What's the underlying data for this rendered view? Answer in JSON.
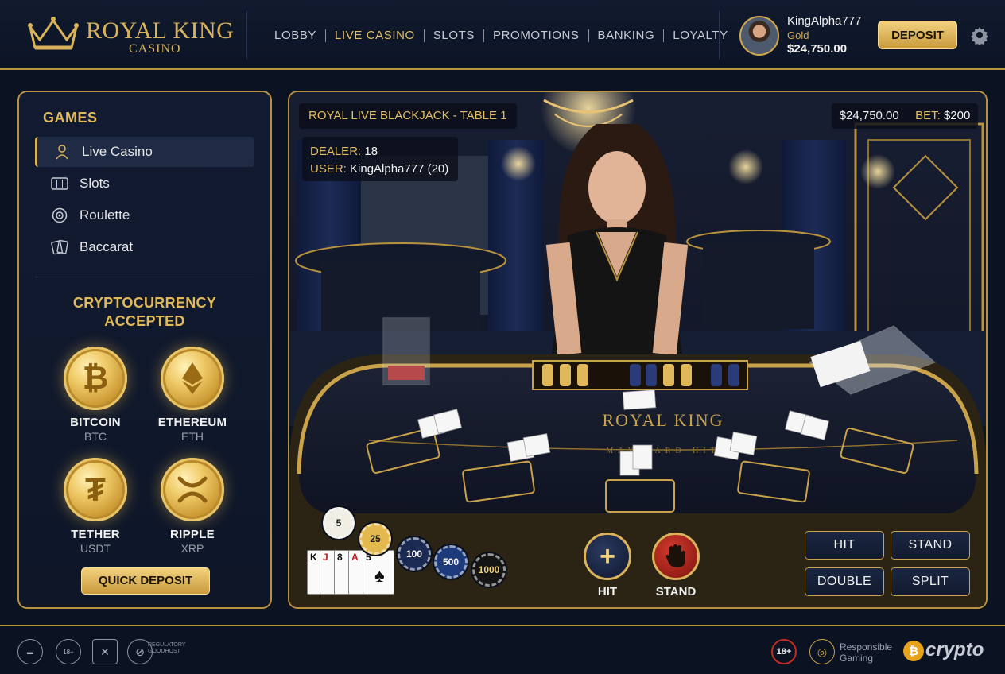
{
  "brand": {
    "name": "ROYAL KING",
    "sub": "CASINO"
  },
  "nav": [
    "LOBBY",
    "LIVE CASINO",
    "SLOTS",
    "PROMOTIONS",
    "BANKING",
    "LOYALTY"
  ],
  "nav_active": "LIVE CASINO",
  "user": {
    "name": "KingAlpha777",
    "tier": "Gold",
    "balance": "$24,750.00"
  },
  "header": {
    "deposit_label": "DEPOSIT",
    "settings_icon": "gear-icon"
  },
  "sidebar": {
    "title": "GAMES",
    "items": [
      {
        "label": "Live Casino",
        "icon": "dealer-icon",
        "active": true
      },
      {
        "label": "Slots",
        "icon": "slot-machine-icon",
        "active": false
      },
      {
        "label": "Roulette",
        "icon": "roulette-icon",
        "active": false
      },
      {
        "label": "Baccarat",
        "icon": "cards-icon",
        "active": false
      }
    ],
    "crypto_title_line1": "CRYPTOCURRENCY",
    "crypto_title_line2": "ACCEPTED",
    "coins": [
      {
        "name": "BITCOIN",
        "symbol": "BTC",
        "glyph": "₿"
      },
      {
        "name": "ETHEREUM",
        "symbol": "ETH",
        "glyph": "◆"
      },
      {
        "name": "TETHER",
        "symbol": "USDT",
        "glyph": "₮"
      },
      {
        "name": "RIPPLE",
        "symbol": "XRP",
        "glyph": "✕"
      }
    ],
    "quick_deposit_label": "QUICK DEPOSIT"
  },
  "game": {
    "table_title": "ROYAL LIVE BLACKJACK - TABLE 1",
    "dealer_label": "DEALER:",
    "dealer_value": "18",
    "user_label": "USER:",
    "user_value": "KingAlpha777 (20)",
    "balance": "$24,750.00",
    "bet_label": "BET:",
    "bet_value": "$200",
    "felt_brand": "ROYAL KING",
    "felt_arc_text": "MAY CARD HIT",
    "hand_cards": [
      "K",
      "J",
      "8",
      "A",
      "5"
    ],
    "chips": [
      {
        "value": "5",
        "color": "#f1eee6",
        "text_color": "#1a1a1a"
      },
      {
        "value": "25",
        "color": "#e2b84f",
        "text_color": "#1a1a1a"
      },
      {
        "value": "100",
        "color": "#1b2a52",
        "text_color": "#ffffff"
      },
      {
        "value": "500",
        "color": "#1d3a7a",
        "text_color": "#ffffff"
      },
      {
        "value": "1000",
        "color": "#151515",
        "text_color": "#f0d27a"
      }
    ],
    "hit_label": "HIT",
    "stand_label": "STAND",
    "actions": [
      "HIT",
      "STAND",
      "DOUBLE",
      "SPLIT"
    ]
  },
  "footer": {
    "age_badge": "18+",
    "regulatory_text": "REGULATORY GOODHOST",
    "responsible_line1": "Responsible",
    "responsible_line2": "Gaming",
    "crypto_word": "crypto"
  },
  "colors": {
    "gold": "#d9b25a",
    "navy": "#0b1222",
    "panel": "#121b31",
    "felt": "#141a2c",
    "red": "#b3211c"
  }
}
